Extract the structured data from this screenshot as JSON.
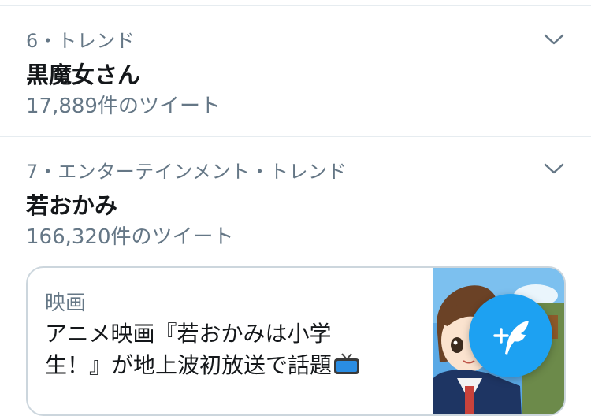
{
  "trends": [
    {
      "meta": "6・トレンド",
      "name": "黒魔女さん",
      "count": "17,889件のツイート"
    },
    {
      "meta": "7・エンターテインメント・トレンド",
      "name": "若おかみ",
      "count": "166,320件のツイート"
    }
  ],
  "card": {
    "category": "映画",
    "title": "アニメ映画『若おかみは小学生！』が地上波初放送で話題",
    "emoji_icon": "television-icon"
  },
  "compose": {
    "icon": "compose-tweet-icon",
    "color": "#1da1f2"
  },
  "colors": {
    "accent": "#1da1f2",
    "secondary_text": "#657786",
    "divider": "#e6ecf0"
  }
}
